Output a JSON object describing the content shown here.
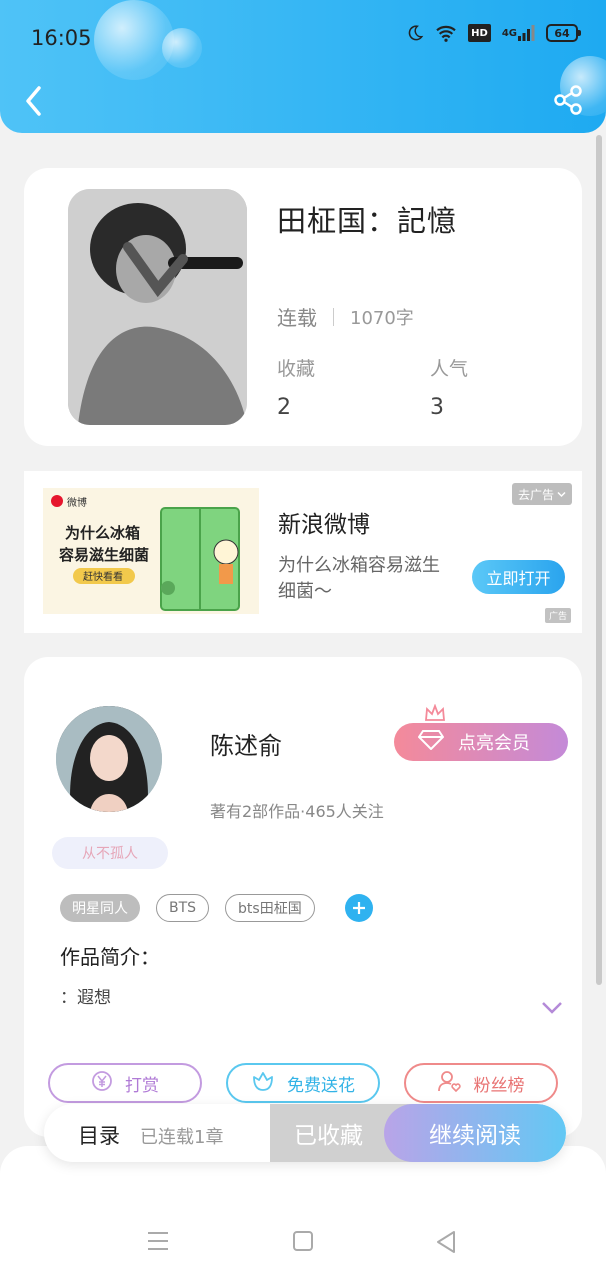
{
  "status_bar": {
    "time": "16:05",
    "network": "4G",
    "hd": "HD",
    "battery": "64"
  },
  "header": {
    "back_icon": "chevron-left-icon",
    "share_icon": "share-icon",
    "bg_color": "#29b6f6"
  },
  "book": {
    "title": "田柾国：記憶",
    "status": "连载",
    "word_count": "1070字",
    "favorites_label": "收藏",
    "favorites_value": "2",
    "popularity_label": "人气",
    "popularity_value": "3"
  },
  "ad": {
    "close_label": "去广告",
    "image_text_line1": "为什么冰箱",
    "image_text_line2": "容易滋生细菌",
    "image_button": "赶快看看",
    "image_brand": "微博",
    "title": "新浪微博",
    "description": "为什么冰箱容易滋生细菌～",
    "open_button": "立即打开",
    "ad_mark": "广告"
  },
  "author": {
    "name": "陈述俞",
    "meta": "著有2部作品·465人关注",
    "vip_button": "点亮会员",
    "badge": "从不孤人",
    "tags": [
      "明星同人",
      "BTS",
      "bts田柾国"
    ],
    "intro_label": "作品简介：",
    "intro_text": "：遐想",
    "actions": {
      "tip": "打赏",
      "flower": "免费送花",
      "fans": "粉丝榜"
    }
  },
  "bottom_bar": {
    "toc": "目录",
    "toc_sub": "已连载1章",
    "collected": "已收藏",
    "continue": "继续阅读"
  },
  "colors": {
    "accent_blue": "#2aa4ee",
    "vip_pink": "#f48a9a",
    "vip_purple": "#c48ad8"
  }
}
